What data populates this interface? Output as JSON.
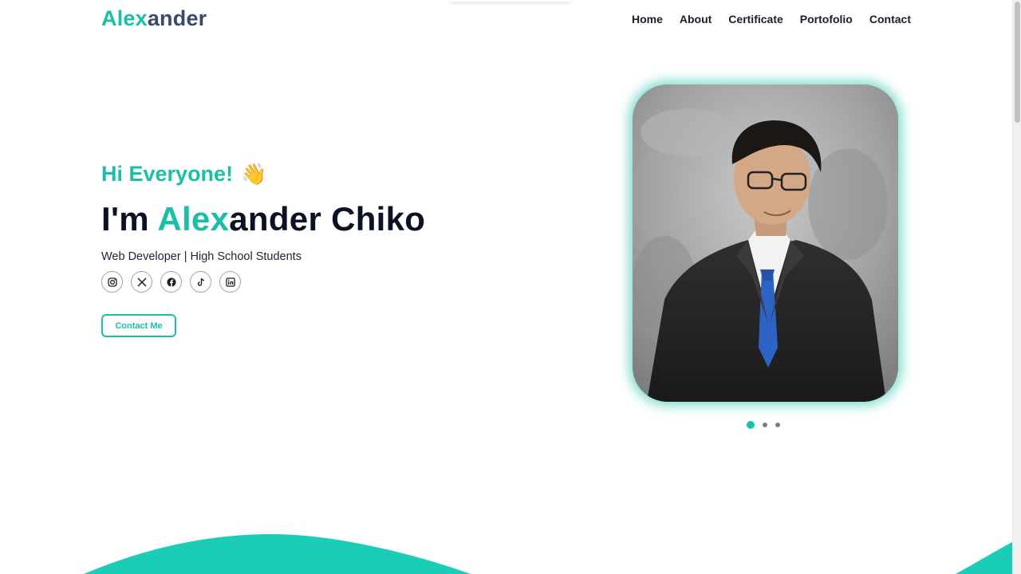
{
  "brand": {
    "accent_part": "Alex",
    "rest_part": "ander"
  },
  "nav": {
    "items": [
      {
        "label": "Home"
      },
      {
        "label": "About"
      },
      {
        "label": "Certificate"
      },
      {
        "label": "Portofolio"
      },
      {
        "label": "Contact"
      }
    ]
  },
  "hero": {
    "greeting": "Hi Everyone!",
    "wave_emoji": "👋",
    "headline_prefix": "I'm ",
    "headline_highlight": "Alex",
    "headline_rest": "ander Chiko",
    "subtitle": "Web Developer | High School Students",
    "socials": [
      {
        "icon": "instagram-icon"
      },
      {
        "icon": "x-twitter-icon"
      },
      {
        "icon": "facebook-icon"
      },
      {
        "icon": "tiktok-icon"
      },
      {
        "icon": "linkedin-icon"
      }
    ],
    "cta_label": "Contact Me"
  },
  "carousel": {
    "slides": 3,
    "active_index": 0
  },
  "colors": {
    "accent": "#1bbfa7",
    "text_dark": "#0d1124",
    "logo_rest": "#3b4a6b"
  }
}
